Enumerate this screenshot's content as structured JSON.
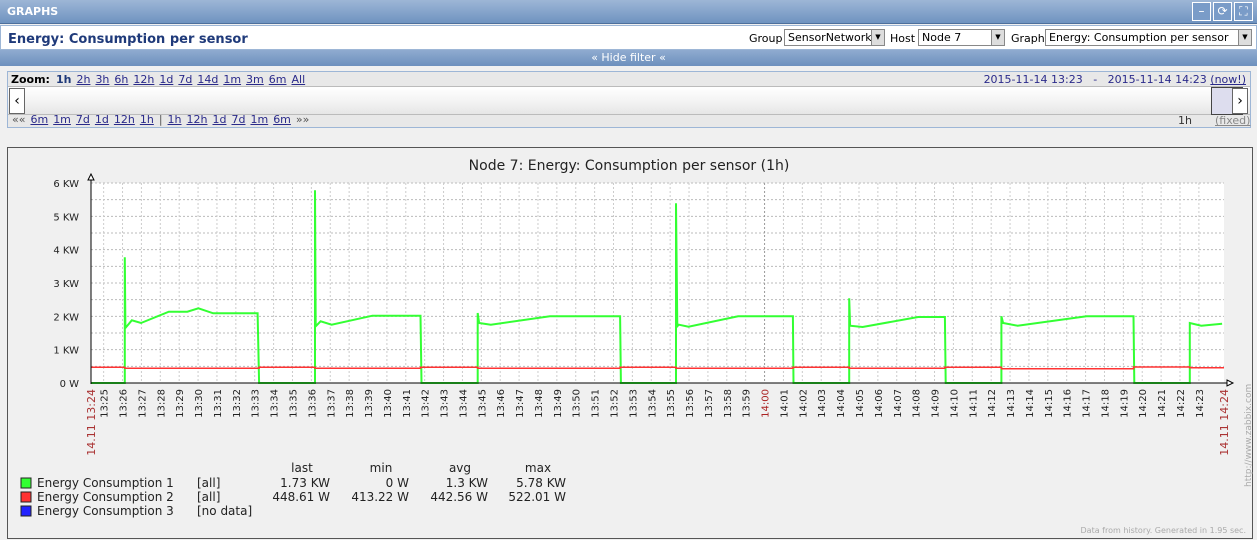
{
  "header": {
    "title": "GRAPHS",
    "buttons": [
      "minimize",
      "refresh",
      "fullscreen"
    ]
  },
  "page": {
    "title": "Energy: Consumption per sensor"
  },
  "filters": {
    "group_label": "Group",
    "group_value": "SensorNetwork",
    "host_label": "Host",
    "host_value": "Node 7",
    "graph_label": "Graph",
    "graph_value": "Energy: Consumption per sensor"
  },
  "filter_toggle": "« Hide filter «",
  "zoom": {
    "label": "Zoom:",
    "options": [
      "1h",
      "2h",
      "3h",
      "6h",
      "12h",
      "1d",
      "7d",
      "14d",
      "1m",
      "3m",
      "6m",
      "All"
    ],
    "active": "1h",
    "from": "2015-11-14 13:23",
    "sep": "-",
    "to": "2015-11-14 14:23",
    "now": "(now!)"
  },
  "nav": {
    "back": "««",
    "back_options": [
      "6m",
      "1m",
      "7d",
      "1d",
      "12h",
      "1h"
    ],
    "divider": "|",
    "fwd_options": [
      "1h",
      "12h",
      "1d",
      "7d",
      "1m",
      "6m"
    ],
    "fwd": "»»",
    "period": "1h",
    "fixed": "(fixed)"
  },
  "chart_data": {
    "type": "line",
    "title": "Node 7: Energy: Consumption per sensor (1h)",
    "xlabel": "",
    "ylabel": "",
    "x_unit": "minutes since 14.11 13:24",
    "xlim": [
      0,
      60
    ],
    "ylim": [
      0,
      6
    ],
    "y_ticks": [
      "0 W",
      "1 KW",
      "2 KW",
      "3 KW",
      "4 KW",
      "5 KW",
      "6 KW"
    ],
    "x_ticks": [
      "13:25",
      "13:26",
      "13:27",
      "13:28",
      "13:29",
      "13:30",
      "13:31",
      "13:32",
      "13:33",
      "13:34",
      "13:35",
      "13:36",
      "13:37",
      "13:38",
      "13:39",
      "13:40",
      "13:41",
      "13:42",
      "13:43",
      "13:44",
      "13:45",
      "13:46",
      "13:47",
      "13:48",
      "13:49",
      "13:50",
      "13:51",
      "13:52",
      "13:53",
      "13:54",
      "13:55",
      "13:56",
      "13:57",
      "13:58",
      "13:59",
      "14:00",
      "14:01",
      "14:02",
      "14:03",
      "14:04",
      "14:05",
      "14:06",
      "14:07",
      "14:08",
      "14:09",
      "14:10",
      "14:11",
      "14:12",
      "14:13",
      "14:14",
      "14:15",
      "14:16",
      "14:17",
      "14:18",
      "14:19",
      "14:20",
      "14:21",
      "14:22",
      "14:23"
    ],
    "highlight_tick": "14:00",
    "start_label": "14.11 13:24",
    "end_label": "14.11 14:24",
    "grid": true,
    "series": [
      {
        "name": "Energy Consumption 1",
        "color": "#33ff33",
        "scope": "[all]",
        "last": "1.73 KW",
        "min": "0 W",
        "avg": "1.3 KW",
        "max": "5.78 KW",
        "points": [
          [
            0,
            0
          ],
          [
            1.79,
            0
          ],
          [
            1.79,
            3.77
          ],
          [
            1.82,
            1.65
          ],
          [
            2.16,
            1.88
          ],
          [
            2.65,
            1.8
          ],
          [
            4.12,
            2.14
          ],
          [
            5.1,
            2.14
          ],
          [
            5.69,
            2.24
          ],
          [
            6.47,
            2.09
          ],
          [
            8.82,
            2.09
          ],
          [
            8.9,
            0
          ],
          [
            11.86,
            0
          ],
          [
            11.86,
            5.78
          ],
          [
            11.9,
            1.7
          ],
          [
            12.16,
            1.85
          ],
          [
            12.74,
            1.75
          ],
          [
            14.9,
            2.02
          ],
          [
            17.45,
            2.02
          ],
          [
            17.5,
            0
          ],
          [
            20.48,
            0
          ],
          [
            20.48,
            2.1
          ],
          [
            20.55,
            1.8
          ],
          [
            21.17,
            1.75
          ],
          [
            24.3,
            2.0
          ],
          [
            28.02,
            2.0
          ],
          [
            28.06,
            0
          ],
          [
            30.98,
            0
          ],
          [
            30.98,
            5.39
          ],
          [
            31.05,
            1.7
          ],
          [
            31.13,
            1.75
          ],
          [
            31.64,
            1.69
          ],
          [
            34.27,
            2.0
          ],
          [
            37.17,
            2.0
          ],
          [
            37.2,
            0
          ],
          [
            40.15,
            0
          ],
          [
            40.15,
            2.54
          ],
          [
            40.2,
            1.72
          ],
          [
            40.86,
            1.68
          ],
          [
            43.8,
            1.98
          ],
          [
            45.22,
            1.98
          ],
          [
            45.26,
            0
          ],
          [
            48.21,
            0
          ],
          [
            48.21,
            2.0
          ],
          [
            48.3,
            1.8
          ],
          [
            49.07,
            1.72
          ],
          [
            52.72,
            2.0
          ],
          [
            55.21,
            2.0
          ],
          [
            55.25,
            0
          ],
          [
            58.19,
            0
          ],
          [
            58.19,
            1.8
          ],
          [
            58.8,
            1.72
          ],
          [
            59.9,
            1.78
          ]
        ]
      },
      {
        "name": "Energy Consumption 2",
        "color": "#ff3333",
        "scope": "[all]",
        "last": "448.61 W",
        "min": "413.22 W",
        "avg": "442.56 W",
        "max": "522.01 W",
        "points": [
          [
            0,
            0.47
          ],
          [
            1.79,
            0.47
          ],
          [
            1.79,
            0.44
          ],
          [
            8.9,
            0.44
          ],
          [
            8.9,
            0.47
          ],
          [
            11.86,
            0.47
          ],
          [
            11.86,
            0.44
          ],
          [
            17.45,
            0.44
          ],
          [
            17.45,
            0.47
          ],
          [
            20.48,
            0.47
          ],
          [
            20.48,
            0.44
          ],
          [
            28.02,
            0.44
          ],
          [
            28.02,
            0.47
          ],
          [
            30.98,
            0.47
          ],
          [
            30.98,
            0.44
          ],
          [
            37.17,
            0.44
          ],
          [
            37.17,
            0.47
          ],
          [
            40.15,
            0.47
          ],
          [
            40.15,
            0.44
          ],
          [
            45.22,
            0.44
          ],
          [
            45.22,
            0.47
          ],
          [
            48.21,
            0.47
          ],
          [
            48.21,
            0.43
          ],
          [
            55.21,
            0.43
          ],
          [
            55.21,
            0.48
          ],
          [
            58.19,
            0.48
          ],
          [
            58.19,
            0.46
          ],
          [
            60,
            0.46
          ]
        ]
      },
      {
        "name": "Energy Consumption 3",
        "color": "#2222ff",
        "scope": "[no data]",
        "last": "",
        "min": "",
        "avg": "",
        "max": "",
        "points": []
      }
    ],
    "legend_columns": [
      "last",
      "min",
      "avg",
      "max"
    ],
    "legend_position": "bottom-left",
    "watermark": "http://www.zabbix.com",
    "footer": "Data from history. Generated in 1.95 sec."
  }
}
